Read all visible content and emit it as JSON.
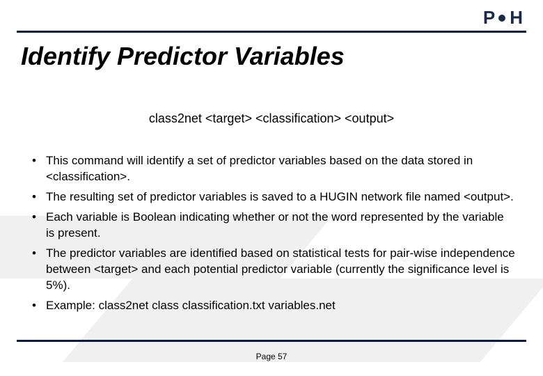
{
  "logo": {
    "p": "P",
    "h": "H"
  },
  "title": "Identify Predictor Variables",
  "command": "class2net <target> <classification> <output>",
  "bullets": [
    "This command will identify a set of predictor variables based on the data stored in <classification>.",
    "The resulting set of predictor variables is saved to a HUGIN network file named <output>.",
    "Each variable is Boolean indicating whether or not the word represented by the variable is present.",
    "The predictor variables are identified based on statistical tests for pair-wise independence between <target> and each potential predictor variable (currently the significance level is 5%).",
    "Example: class2net class classification.txt variables.net"
  ],
  "footer": "Page 57"
}
